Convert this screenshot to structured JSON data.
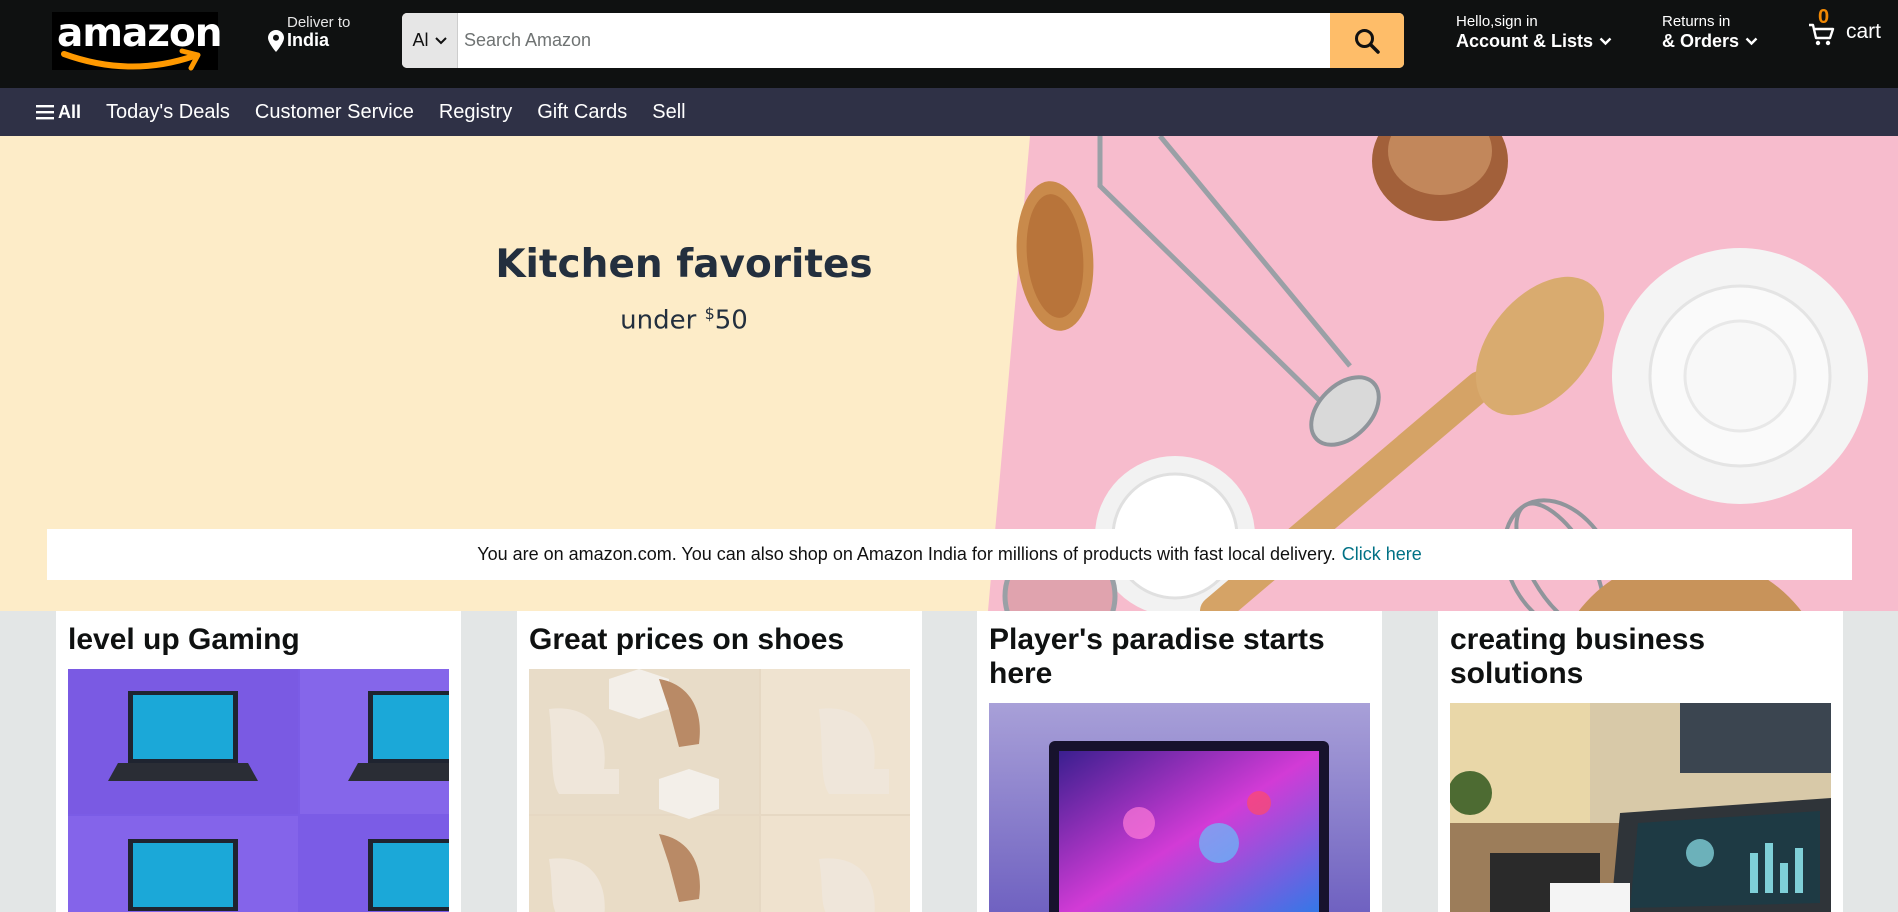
{
  "header": {
    "logo_text": "amazon",
    "deliver_label": "Deliver to",
    "deliver_location": "India",
    "search": {
      "category": "Al",
      "placeholder": "Search Amazon"
    },
    "account": {
      "line1": "Hello,sign in",
      "line2": "Account & Lists"
    },
    "returns": {
      "line1": "Returns in",
      "line2": "& Orders"
    },
    "cart": {
      "count": "0",
      "label": "cart"
    },
    "colors": {
      "nav_bg": "#0f1111",
      "sub_nav_bg": "#2f3146",
      "search_button": "#febd69",
      "cart_count": "#f08804"
    },
    "icons": [
      "location-pin-icon",
      "chevron-down-icon",
      "search-icon",
      "cart-icon",
      "hamburger-menu-icon"
    ]
  },
  "subnav": {
    "all_label": "All",
    "links": [
      "Today's Deals",
      "Customer Service",
      "Registry",
      "Gift Cards",
      "Sell"
    ]
  },
  "hero": {
    "title": "Kitchen favorites",
    "subtitle_prefix": "under ",
    "currency": "$",
    "price": "50",
    "bg_color": "#fdecc8",
    "art_bg_color": "#f7bccd"
  },
  "notice": {
    "text": "You are on amazon.com. You can also shop on Amazon India for millions of products with fast local delivery.",
    "link": "Click here"
  },
  "cards": [
    {
      "title": "level up Gaming"
    },
    {
      "title": "Great prices on shoes"
    },
    {
      "title": "Player's paradise starts here"
    },
    {
      "title": "creating business solutions"
    }
  ]
}
